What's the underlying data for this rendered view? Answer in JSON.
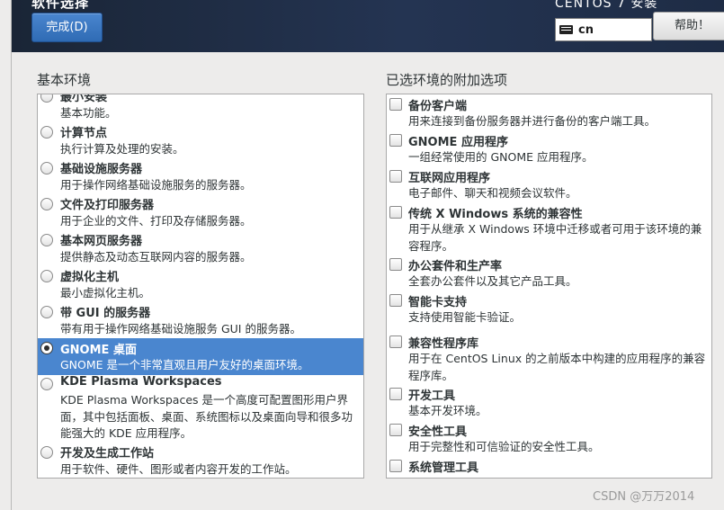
{
  "header": {
    "title": "软件选择",
    "done_label": "完成(D)",
    "product": "CENTOS 7 安装",
    "keyboard_layout": "cn",
    "help_label": "帮助！"
  },
  "base_environment": {
    "label": "基本环境",
    "items": [
      {
        "title": "最小安装",
        "desc": "基本功能。",
        "selected": false
      },
      {
        "title": "计算节点",
        "desc": "执行计算及处理的安装。",
        "selected": false
      },
      {
        "title": "基础设施服务器",
        "desc": "用于操作网络基础设施服务的服务器。",
        "selected": false
      },
      {
        "title": "文件及打印服务器",
        "desc": "用于企业的文件、打印及存储服务器。",
        "selected": false
      },
      {
        "title": "基本网页服务器",
        "desc": "提供静态及动态互联网内容的服务器。",
        "selected": false
      },
      {
        "title": "虚拟化主机",
        "desc": "最小虚拟化主机。",
        "selected": false
      },
      {
        "title": "带 GUI 的服务器",
        "desc": "带有用于操作网络基础设施服务 GUI 的服务器。",
        "selected": false
      },
      {
        "title": "GNOME 桌面",
        "desc": "GNOME 是一个非常直观且用户友好的桌面环境。",
        "selected": true
      },
      {
        "title": "KDE Plasma Workspaces",
        "desc": "KDE Plasma Workspaces 是一个高度可配置图形用户界面，其中包括面板、桌面、系统图标以及桌面向导和很多功能强大的 KDE 应用程序。",
        "selected": false
      },
      {
        "title": "开发及生成工作站",
        "desc": "用于软件、硬件、图形或者内容开发的工作站。",
        "selected": false
      }
    ]
  },
  "addons": {
    "label": "已选环境的附加选项",
    "items": [
      {
        "title": "备份客户端",
        "desc": "用来连接到备份服务器并进行备份的客户端工具。",
        "checked": false
      },
      {
        "title": "GNOME 应用程序",
        "desc": "一组经常使用的 GNOME 应用程序。",
        "checked": false
      },
      {
        "title": "互联网应用程序",
        "desc": "电子邮件、聊天和视频会议软件。",
        "checked": false
      },
      {
        "title": "传统 X Windows 系统的兼容性",
        "desc": "用于从继承 X Windows 环境中迁移或者可用于该环境的兼容程序。",
        "checked": false
      },
      {
        "title": "办公套件和生产率",
        "desc": "全套办公套件以及其它产品工具。",
        "checked": false
      },
      {
        "title": "智能卡支持",
        "desc": "支持使用智能卡验证。",
        "checked": false
      },
      {
        "title": "兼容性程序库",
        "desc": "用于在 CentOS Linux 的之前版本中构建的应用程序的兼容程序库。",
        "checked": false
      },
      {
        "title": "开发工具",
        "desc": "基本开发环境。",
        "checked": false
      },
      {
        "title": "安全性工具",
        "desc": "用于完整性和可信验证的安全性工具。",
        "checked": false
      },
      {
        "title": "系统管理工具",
        "desc": "",
        "checked": false
      }
    ]
  },
  "watermark": "CSDN @万万2014",
  "colors": {
    "header_bg": "#1e2c45",
    "selection": "#4a86cf",
    "background": "#edeceb"
  }
}
